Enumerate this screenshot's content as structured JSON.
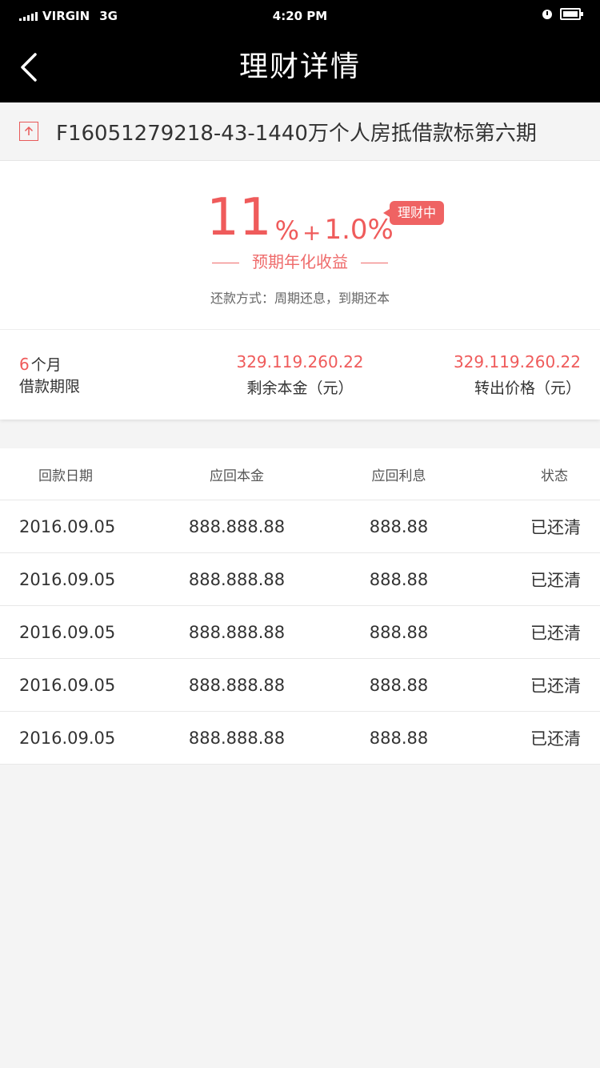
{
  "status_bar": {
    "carrier": "VIRGIN",
    "network": "3G",
    "time": "4:20 PM",
    "icons": [
      "signal-icon",
      "alarm-icon",
      "battery-icon"
    ]
  },
  "nav": {
    "title": "理财详情",
    "back_icon": "chevron-left-icon"
  },
  "product": {
    "icon": "upload-arrow-icon",
    "name": "F16051279218-43-1440万个人房抵借款标第六期"
  },
  "summary": {
    "rate_main": "11",
    "rate_pct": "%",
    "rate_plus": "+",
    "rate_bonus": "1.0%",
    "status_badge": "理财中",
    "rate_label": "预期年化收益",
    "repay_method": "还款方式：周期还息，到期还本",
    "accent_color": "#ef5b5b"
  },
  "stats": {
    "term_value": "6",
    "term_unit": "个月",
    "term_label": "借款期限",
    "remaining_value": "329.119.260.22",
    "remaining_label": "剩余本金（元）",
    "transfer_value": "329.119.260.22",
    "transfer_label": "转出价格（元）"
  },
  "table": {
    "headers": [
      "回款日期",
      "应回本金",
      "应回利息",
      "状态"
    ],
    "rows": [
      [
        "2016.09.05",
        "888.888.88",
        "888.88",
        "已还清"
      ],
      [
        "2016.09.05",
        "888.888.88",
        "888.88",
        "已还清"
      ],
      [
        "2016.09.05",
        "888.888.88",
        "888.88",
        "已还清"
      ],
      [
        "2016.09.05",
        "888.888.88",
        "888.88",
        "已还清"
      ],
      [
        "2016.09.05",
        "888.888.88",
        "888.88",
        "已还清"
      ]
    ]
  }
}
